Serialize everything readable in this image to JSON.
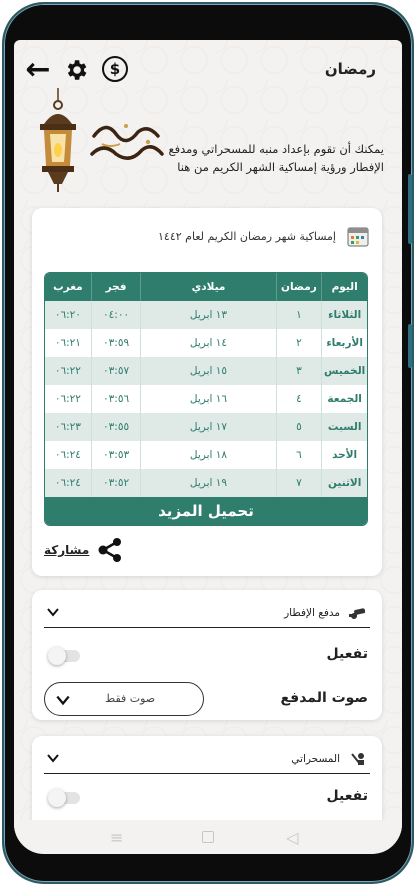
{
  "header": {
    "title": "رمضان",
    "intro_text": "يمكنك أن تقوم بإعداد منبه للمسحراتي ومدفع الإفطار ورؤية إمساكية الشهر الكريم من هنا"
  },
  "imsak": {
    "title": "إمساكية شهر رمضان الكريم لعام ١٤٤٢",
    "columns": [
      "اليوم",
      "رمضان",
      "ميلادي",
      "فجر",
      "مغرب"
    ],
    "rows": [
      [
        "الثلاثاء",
        "١",
        "١٣ ابريل",
        "٠٤:٠٠",
        "٠٦:٢٠"
      ],
      [
        "الأربعاء",
        "٢",
        "١٤ ابريل",
        "٠٣:٥٩",
        "٠٦:٢١"
      ],
      [
        "الخميس",
        "٣",
        "١٥ ابريل",
        "٠٣:٥٧",
        "٠٦:٢٢"
      ],
      [
        "الجمعة",
        "٤",
        "١٦ ابريل",
        "٠٣:٥٦",
        "٠٦:٢٢"
      ],
      [
        "السبت",
        "٥",
        "١٧ ابريل",
        "٠٣:٥٥",
        "٠٦:٢٣"
      ],
      [
        "الأحد",
        "٦",
        "١٨ ابريل",
        "٠٣:٥٣",
        "٠٦:٢٤"
      ],
      [
        "الاثنين",
        "٧",
        "١٩ ابريل",
        "٠٣:٥٢",
        "٠٦:٢٤"
      ]
    ],
    "load_more": "تحميل المزيد",
    "share": "مشاركة"
  },
  "cannon": {
    "title": "مدفع الإفطار",
    "activate_label": "تفعيل",
    "sound_label": "صوت المدفع",
    "sound_value": "صوت فقط"
  },
  "misaharati": {
    "title": "المسحراتي",
    "activate_label": "تفعيل"
  },
  "colors": {
    "accent": "#2f7d6d",
    "row_alt": "#dfe9e6",
    "frame": "#2d5a66"
  }
}
